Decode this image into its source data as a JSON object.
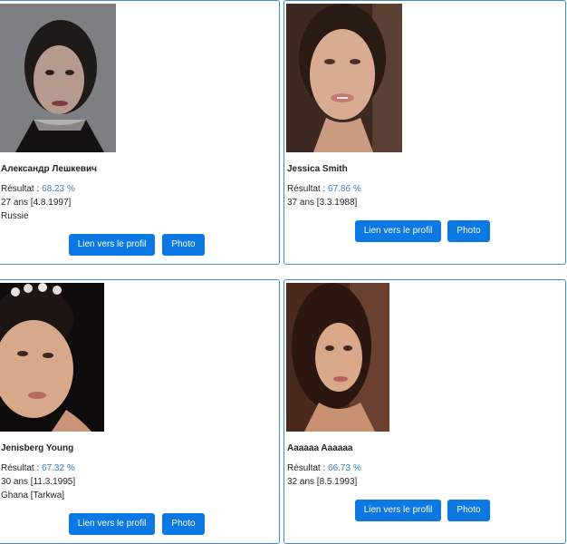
{
  "profiles": [
    {
      "name": "Александр Лешкевич",
      "result_label": "Résultat : ",
      "result_value": "68.23 %",
      "age": "27 ans [4.8.1997]",
      "location": "Russie",
      "profile_button": "Lien vers le profil",
      "photo_button": "Photo"
    },
    {
      "name": "Jessica Smith",
      "result_label": "Résultat : ",
      "result_value": "67.86 %",
      "age": "37 ans [3.3.1988]",
      "location": "",
      "profile_button": "Lien vers le profil",
      "photo_button": "Photo"
    },
    {
      "name": "Jenisberg Young",
      "result_label": "Résultat : ",
      "result_value": "67.32 %",
      "age": "30 ans [11.3.1995]",
      "location": "Ghana [Tarkwa]",
      "profile_button": "Lien vers le profil",
      "photo_button": "Photo"
    },
    {
      "name": "Aaaaaa Aaaaaa",
      "result_label": "Résultat : ",
      "result_value": "66.73 %",
      "age": "32 ans [8.5.1993]",
      "location": "",
      "profile_button": "Lien vers le profil",
      "photo_button": "Photo"
    }
  ],
  "colors": {
    "card_border": "#3d8fc4",
    "button_bg": "#0b78e3",
    "score_text": "#3c7fc0"
  }
}
